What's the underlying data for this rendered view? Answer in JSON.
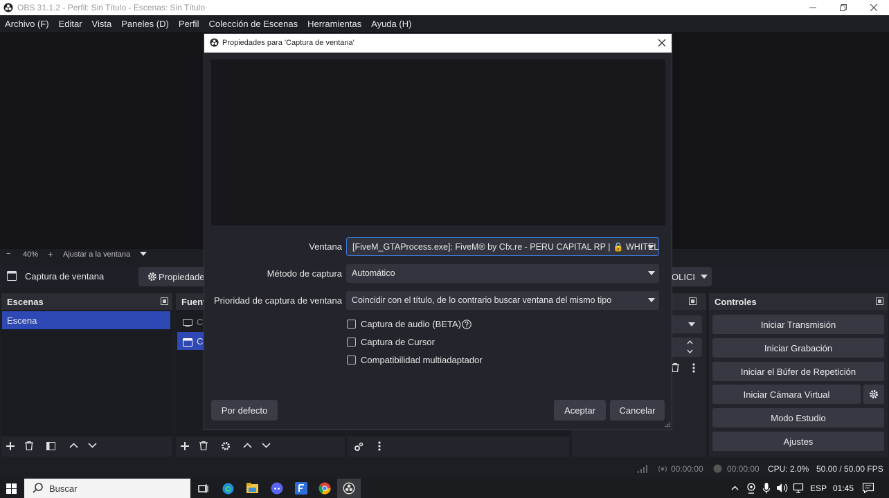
{
  "window": {
    "title": "OBS 31.1.2 - Perfil: Sin Título - Escenas: Sin Título"
  },
  "menu": [
    "Archivo (F)",
    "Editar",
    "Vista",
    "Paneles (D)",
    "Perfil",
    "Colección de Escenas",
    "Herramientas",
    "Ayuda (H)"
  ],
  "zoom": {
    "level": "40%",
    "fit": "Ajustar a la ventana"
  },
  "sourcebar": {
    "source_name": "Captura de ventana",
    "properties": "Propiedades",
    "combo_value": "OLICI"
  },
  "scenes": {
    "title": "Escenas",
    "items": [
      "Escena"
    ]
  },
  "sources": {
    "title": "Fuent",
    "items": [
      "Ca",
      "Ca"
    ]
  },
  "controls": {
    "title": "Controles",
    "buttons": [
      "Iniciar Transmisión",
      "Iniciar Grabación",
      "Iniciar el Búfer de Repetición",
      "Iniciar Cámara Virtual",
      "Modo Estudio",
      "Ajustes"
    ]
  },
  "status": {
    "stream_time": "00:00:00",
    "rec_time": "00:00:00",
    "cpu": "CPU: 2.0%",
    "fps": "50.00 / 50.00 FPS"
  },
  "taskbar": {
    "search_placeholder": "Buscar",
    "lang": "ESP",
    "time": "01:45"
  },
  "dialog": {
    "title": "Propiedades para 'Captura de ventana'",
    "window_label": "Ventana",
    "window_value": "[FiveM_GTAProcess.exe]: FiveM® by Cfx.re - PERU CAPITAL RP | 🔒 WHITEL",
    "method_label": "Método de captura",
    "method_value": "Automático",
    "priority_label": "Prioridad de captura de ventana",
    "priority_value": "Coincidir con el título, de lo contrario buscar ventana del mismo tipo",
    "audio_label": "Captura de audio (BETA)",
    "cursor_label": "Captura de Cursor",
    "multi_label": "Compatibilidad multiadaptador",
    "defaults_btn": "Por defecto",
    "ok_btn": "Aceptar",
    "cancel_btn": "Cancelar"
  }
}
